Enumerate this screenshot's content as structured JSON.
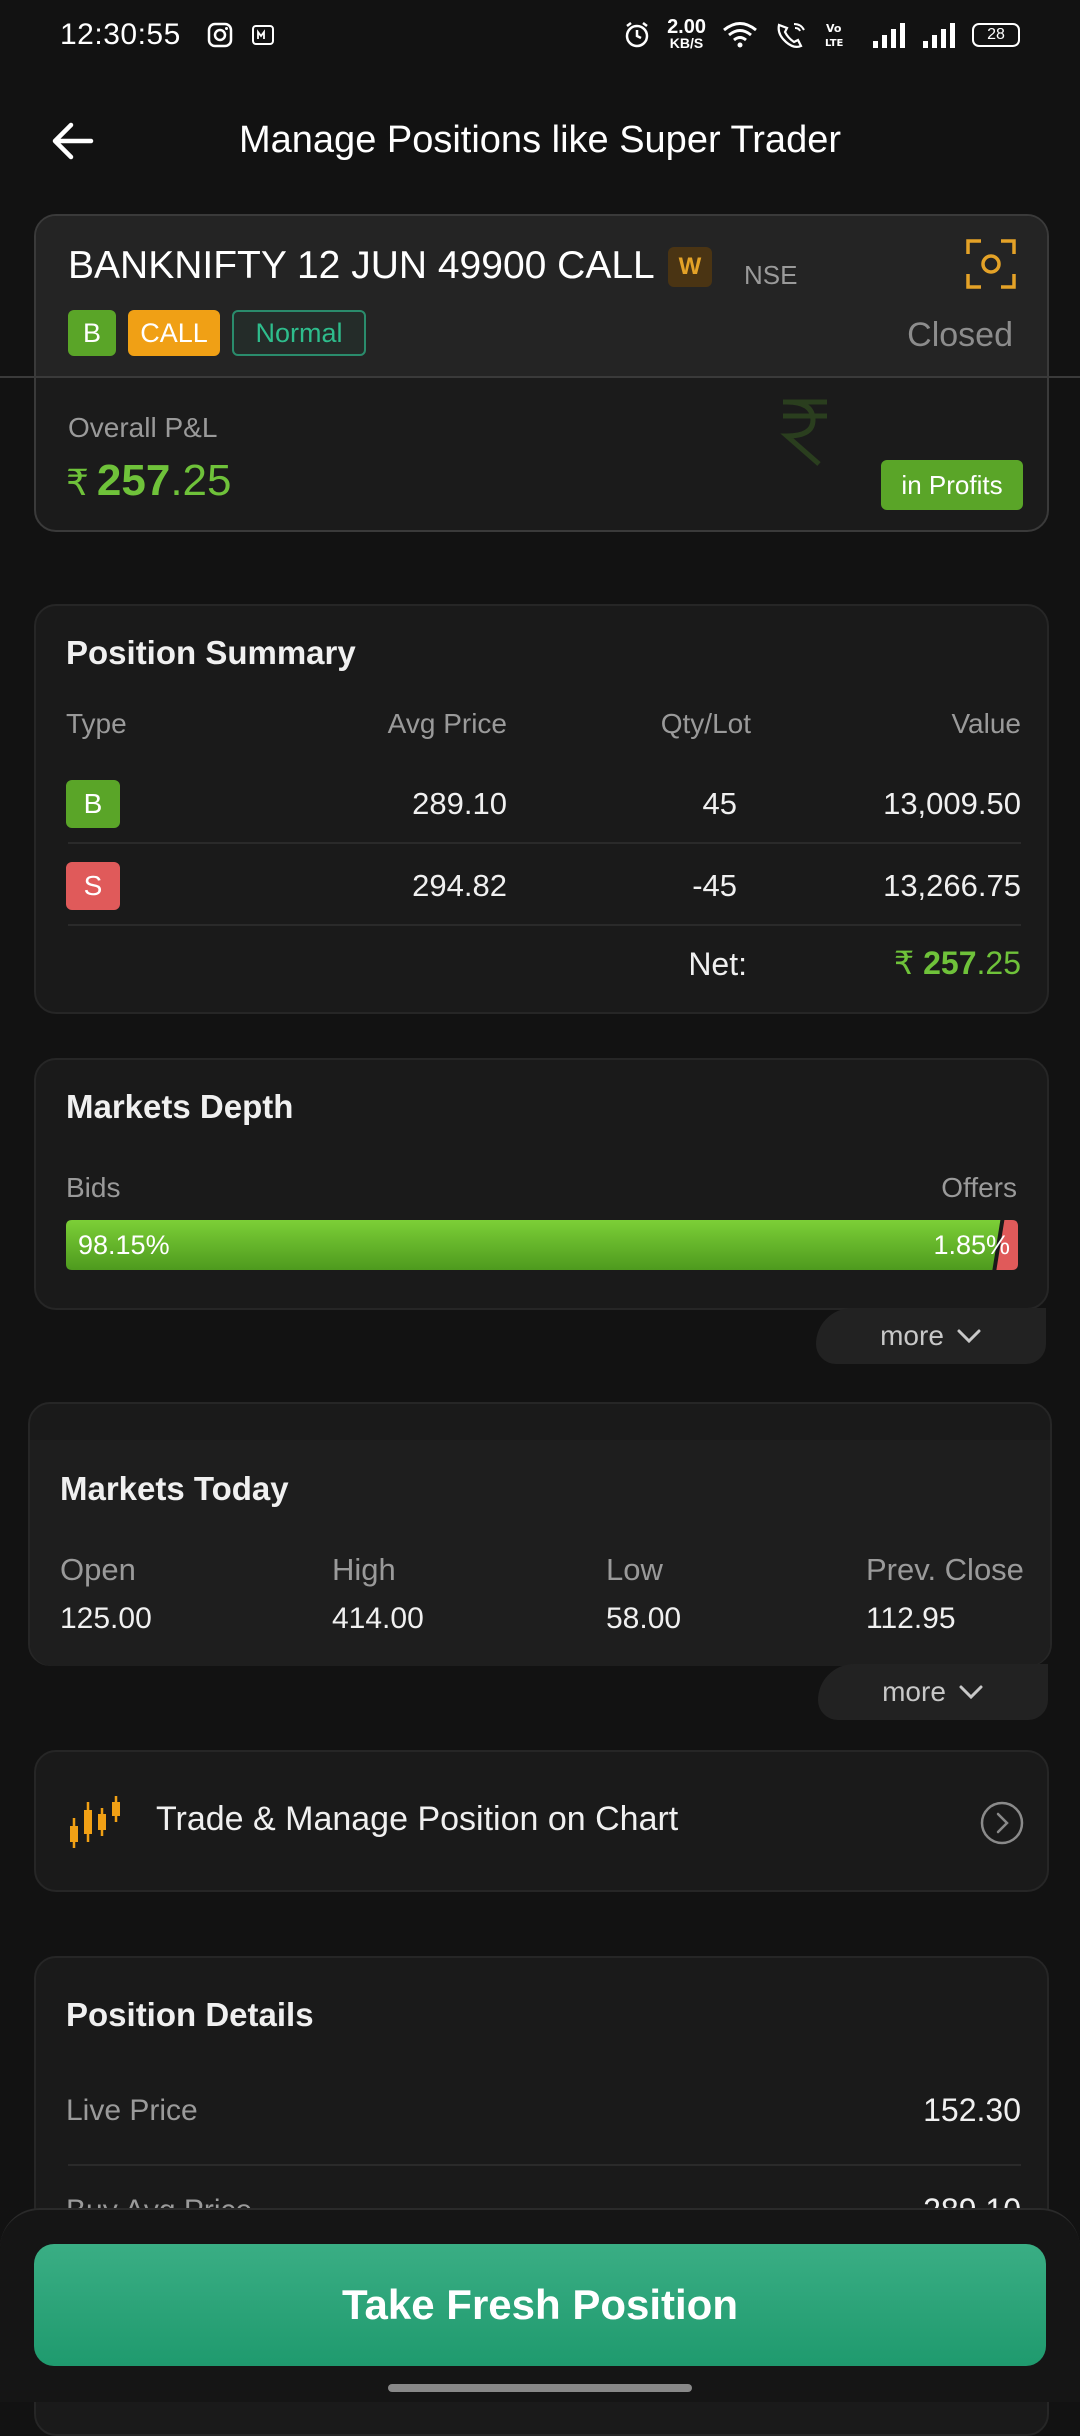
{
  "status_bar": {
    "time": "12:30:55",
    "net_speed_value": "2.00",
    "net_speed_unit": "KB/S",
    "battery": "28"
  },
  "header": {
    "title": "Manage Positions like Super Trader"
  },
  "instrument": {
    "name": "BANKNIFTY 12 JUN 49900 CALL",
    "weekly_badge": "W",
    "exchange": "NSE",
    "side_tag": "B",
    "option_type": "CALL",
    "order_type": "Normal",
    "status": "Closed",
    "pnl_label": "Overall P&L",
    "pnl_currency": "₹",
    "pnl_int": "257",
    "pnl_dec": ".25",
    "profit_badge": "in Profits"
  },
  "position_summary": {
    "title": "Position Summary",
    "columns": [
      "Type",
      "Avg Price",
      "Qty/Lot",
      "Value"
    ],
    "rows": [
      {
        "type": "B",
        "avg_price": "289.10",
        "qty": "45",
        "value": "13,009.50"
      },
      {
        "type": "S",
        "avg_price": "294.82",
        "qty": "-45",
        "value": "13,266.75"
      }
    ],
    "net_label": "Net:",
    "net_currency": "₹",
    "net_int": "257",
    "net_dec": ".25"
  },
  "markets_depth": {
    "title": "Markets Depth",
    "bids_label": "Bids",
    "offers_label": "Offers",
    "bids_pct": 98.15,
    "bids_text": "98.15%",
    "offers_text": "1.85%",
    "more_label": "more"
  },
  "markets_today": {
    "title": "Markets Today",
    "open_label": "Open",
    "open": "125.00",
    "high_label": "High",
    "high": "414.00",
    "low_label": "Low",
    "low": "58.00",
    "prev_close_label": "Prev. Close",
    "prev_close": "112.95",
    "more_label": "more"
  },
  "chart_link": {
    "label": "Trade & Manage Position on Chart"
  },
  "position_details": {
    "title": "Position Details",
    "rows": [
      {
        "label": "Live Price",
        "value": "152.30"
      },
      {
        "label": "Buy Avg Price",
        "value": "289.10"
      }
    ]
  },
  "cta": {
    "label": "Take Fresh Position"
  },
  "colors": {
    "accent_green": "#5aa528",
    "profit_text": "#6fc23a",
    "sell_red": "#e05a5a",
    "call_orange": "#f0a015",
    "cta_green": "#2ba37a"
  }
}
